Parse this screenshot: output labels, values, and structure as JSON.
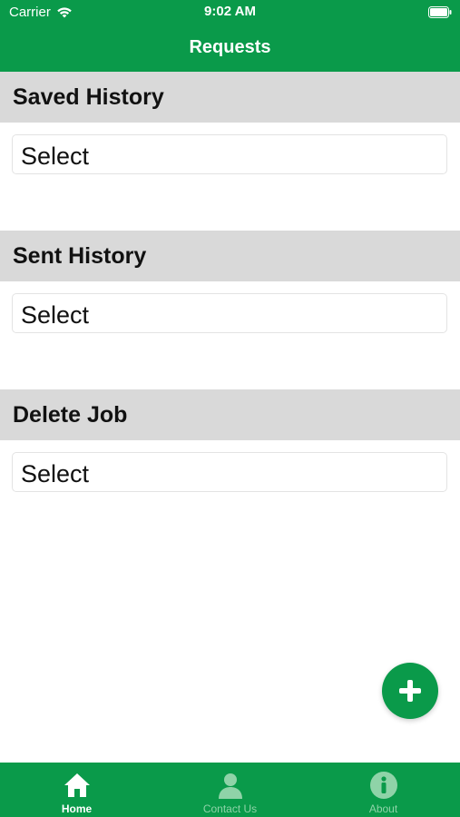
{
  "status_bar": {
    "carrier": "Carrier",
    "time": "9:02 AM",
    "wifi_icon": "wifi-icon",
    "battery_icon": "battery-icon"
  },
  "nav": {
    "title": "Requests"
  },
  "sections": [
    {
      "title": "Saved History",
      "select_value": "Select"
    },
    {
      "title": "Sent History",
      "select_value": "Select"
    },
    {
      "title": "Delete Job",
      "select_value": "Select"
    }
  ],
  "fab": {
    "icon": "plus-icon"
  },
  "tabbar": {
    "items": [
      {
        "label": "Home",
        "icon": "home-icon",
        "active": true
      },
      {
        "label": "Contact Us",
        "icon": "person-icon",
        "active": false
      },
      {
        "label": "About",
        "icon": "info-icon",
        "active": false
      }
    ]
  },
  "colors": {
    "brand_green": "#0a9a4a",
    "section_header_bg": "#d9d9d9",
    "inactive_tab": "#8fd3a8"
  }
}
